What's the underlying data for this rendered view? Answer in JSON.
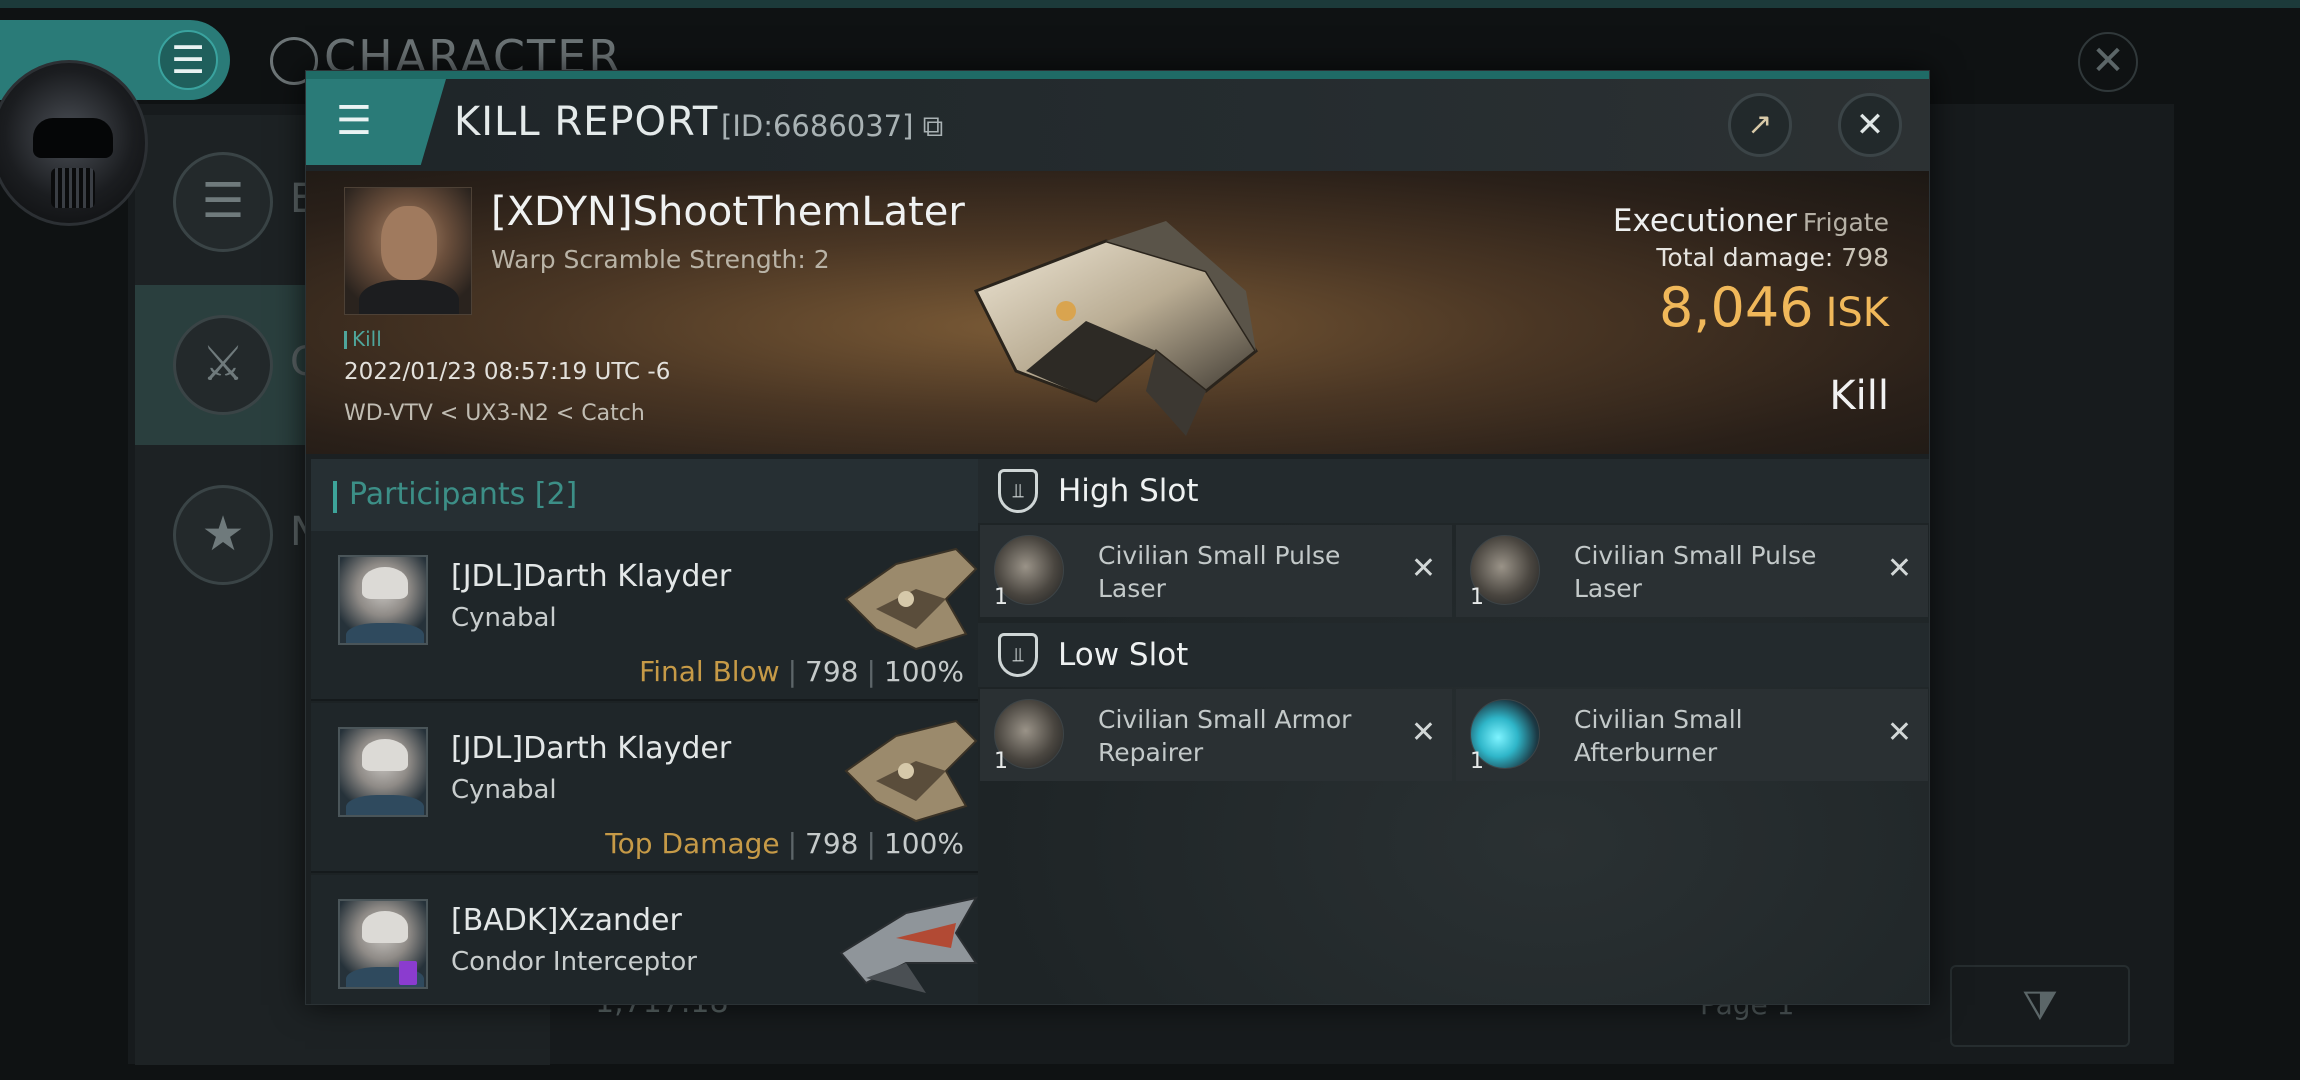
{
  "background": {
    "title": "CHARACTER",
    "sidebar_items": [
      {
        "letter": "E",
        "icon": "list-icon"
      },
      {
        "letter": "C",
        "icon": "crossed-swords-icon"
      },
      {
        "letter": "N",
        "icon": "star-badge-icon"
      }
    ],
    "bottom_value": "1,717.18",
    "page_label": "Page 1"
  },
  "kill_report": {
    "title": "KILL REPORT",
    "id_label": "[ID:6686037]",
    "victim": {
      "name": "[XDYN]ShootThemLater",
      "subtitle": "Warp Scramble Strength: 2",
      "tag": "Kill",
      "datetime": "2022/01/23 08:57:19 UTC -6",
      "location": "WD-VTV < UX3-N2 < Catch"
    },
    "ship": {
      "name": "Executioner",
      "class": "Frigate",
      "total_damage_label": "Total damage:",
      "total_damage": "798",
      "value": "8,046",
      "currency": "ISK",
      "outcome": "Kill"
    },
    "participants": {
      "header": "Participants [2]",
      "rows": [
        {
          "name": "[JDL]Darth Klayder",
          "ship": "Cynabal",
          "role": "Final Blow",
          "damage": "798",
          "percent": "100%"
        },
        {
          "name": "[JDL]Darth Klayder",
          "ship": "Cynabal",
          "role": "Top Damage",
          "damage": "798",
          "percent": "100%"
        },
        {
          "name": "[BADK]Xzander",
          "ship": "Condor Interceptor",
          "role": "",
          "damage": "",
          "percent": ""
        }
      ]
    },
    "slots": [
      {
        "name": "High Slot",
        "modules": [
          {
            "qty": "1",
            "name": "Civilian Small Pulse Laser"
          },
          {
            "qty": "1",
            "name": "Civilian Small Pulse Laser"
          }
        ]
      },
      {
        "name": "Low Slot",
        "modules": [
          {
            "qty": "1",
            "name": "Civilian Small Armor Repairer"
          },
          {
            "qty": "1",
            "name": "Civilian Small Afterburner"
          }
        ]
      }
    ]
  },
  "colors": {
    "accent": "#2a7b78",
    "isk": "#f0b85a",
    "role": "#c69a47"
  }
}
